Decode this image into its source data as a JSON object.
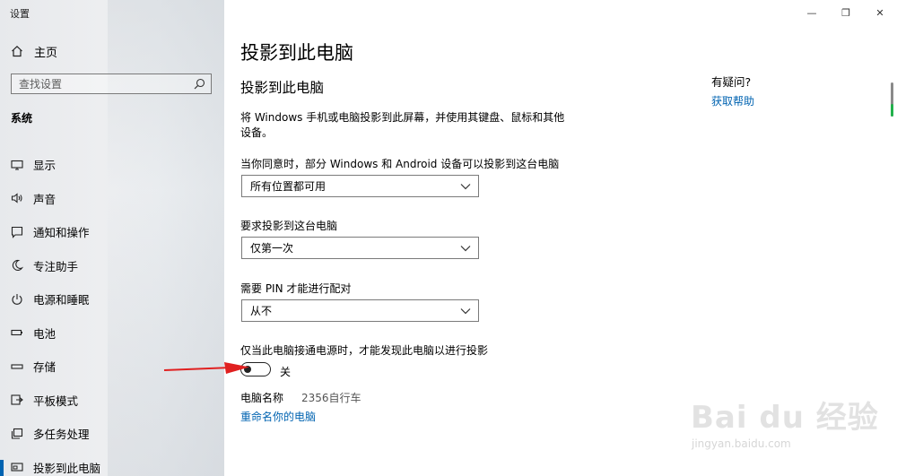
{
  "app": {
    "title": "设置"
  },
  "sidebar": {
    "home_label": "主页",
    "search_placeholder": "查找设置",
    "section_label": "系统",
    "items": [
      {
        "label": "显示",
        "icon": "display-icon"
      },
      {
        "label": "声音",
        "icon": "speaker-icon"
      },
      {
        "label": "通知和操作",
        "icon": "notification-icon"
      },
      {
        "label": "专注助手",
        "icon": "moon-icon"
      },
      {
        "label": "电源和睡眠",
        "icon": "power-icon"
      },
      {
        "label": "电池",
        "icon": "battery-icon"
      },
      {
        "label": "存储",
        "icon": "storage-icon"
      },
      {
        "label": "平板模式",
        "icon": "tablet-icon"
      },
      {
        "label": "多任务处理",
        "icon": "multitask-icon"
      },
      {
        "label": "投影到此电脑",
        "icon": "project-icon",
        "active": true
      }
    ]
  },
  "main": {
    "page_title": "投影到此电脑",
    "subtitle": "投影到此电脑",
    "description": "将 Windows 手机或电脑投影到此屏幕，并使用其键盘、鼠标和其他设备。",
    "setting1": {
      "label": "当你同意时，部分 Windows 和 Android 设备可以投影到这台电脑",
      "value": "所有位置都可用"
    },
    "setting2": {
      "label": "要求投影到这台电脑",
      "value": "仅第一次"
    },
    "setting3": {
      "label": "需要 PIN 才能进行配对",
      "value": "从不"
    },
    "power_setting": {
      "label": "仅当此电脑接通电源时，才能发现此电脑以进行投影",
      "state": "关",
      "on": false
    },
    "pc_name_label": "电脑名称",
    "pc_name_value": "2356自行车",
    "rename_link": "重命名你的电脑"
  },
  "help": {
    "title": "有疑问?",
    "link": "获取帮助"
  },
  "window_controls": {
    "minimize": "—",
    "maximize": "❐",
    "close": "✕"
  },
  "watermark": {
    "main": "Bai du 经验",
    "sub": "jingyan.baidu.com"
  },
  "colors": {
    "accent": "#0063b1",
    "annotation_arrow": "#e02020"
  }
}
